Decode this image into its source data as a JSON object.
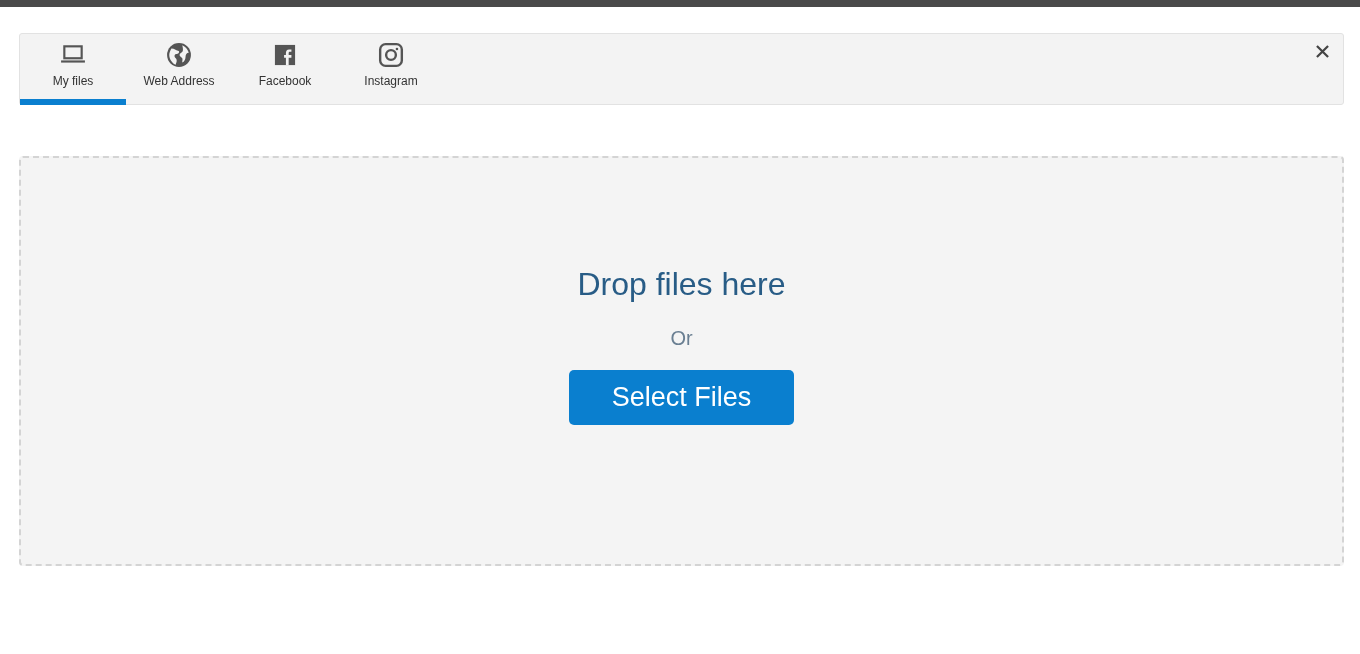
{
  "tabs": [
    {
      "label": "My files",
      "kind": "laptop",
      "selected": true
    },
    {
      "label": "Web Address",
      "kind": "globe",
      "selected": false
    },
    {
      "label": "Facebook",
      "kind": "facebook",
      "selected": false
    },
    {
      "label": "Instagram",
      "kind": "instagram",
      "selected": false
    }
  ],
  "drop_zone": {
    "title": "Drop files here",
    "separator": "Or",
    "button": "Select Files"
  }
}
